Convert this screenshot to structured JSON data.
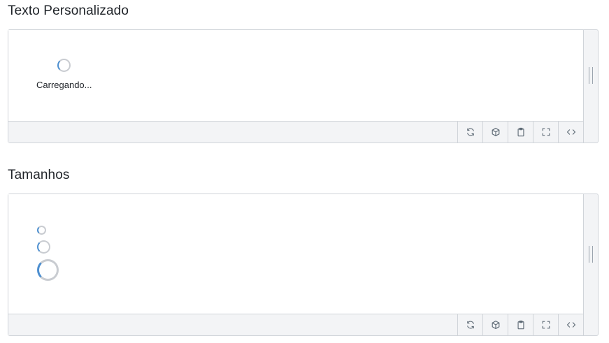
{
  "sections": [
    {
      "title": "Texto Personalizado",
      "spinner_text": "Carregando..."
    },
    {
      "title": "Tamanhos"
    }
  ],
  "toolbar": {
    "buttons": [
      "refresh-icon",
      "cube-icon",
      "clipboard-icon",
      "fullscreen-icon",
      "code-icon"
    ]
  },
  "colors": {
    "spinner_accent": "#4d8fd0",
    "spinner_track": "#c9ccd1",
    "border": "#d0d4d9",
    "toolbar_bg": "#f3f4f6"
  }
}
